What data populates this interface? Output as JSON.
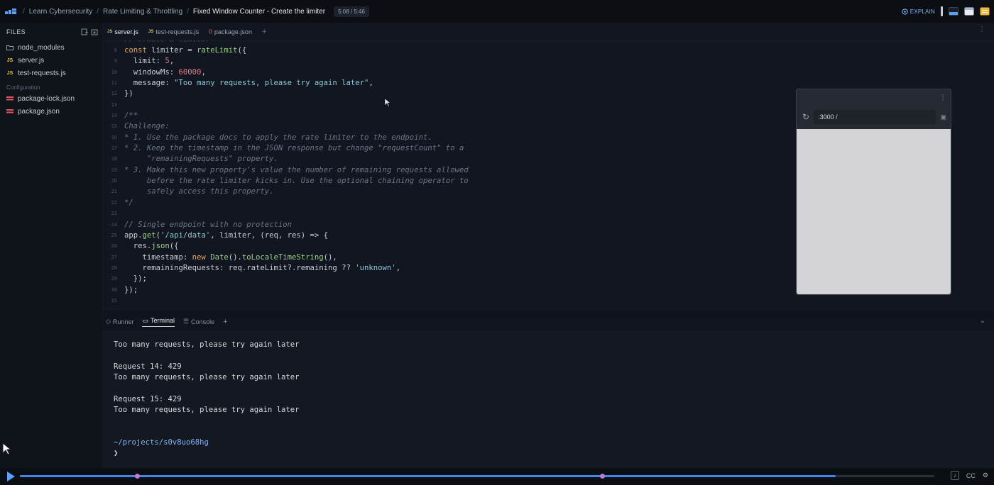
{
  "topbar": {
    "breadcrumb": [
      "Learn Cybersecurity",
      "Rate Limiting & Throttling"
    ],
    "current": "Fixed Window Counter - Create the limiter",
    "time": "5:08 / 5:46",
    "explain_label": "EXPLAIN",
    "accent": "#5aa0ff"
  },
  "sidebar": {
    "title": "FILES",
    "items": [
      {
        "icon": "folder-icon",
        "label": "node_modules"
      },
      {
        "icon": "js-file-icon",
        "badge": "JS",
        "label": "server.js"
      },
      {
        "icon": "js-file-icon",
        "badge": "JS",
        "label": "test-requests.js"
      }
    ],
    "section": "Configuration",
    "config_items": [
      {
        "icon": "json-file-icon",
        "label": "package-lock.json"
      },
      {
        "icon": "json-file-icon",
        "label": "package.json"
      }
    ]
  },
  "editor": {
    "tabs": [
      {
        "badge": "JS",
        "label": "server.js",
        "active": true
      },
      {
        "badge": "JS",
        "label": "test-requests.js",
        "active": false
      },
      {
        "badge": "{}",
        "label": "package.json",
        "active": false
      }
    ],
    "lines": [
      {
        "n": "",
        "tokens": [
          [
            "cm",
            "// create a limiter"
          ]
        ]
      },
      {
        "n": "8",
        "tokens": [
          [
            "kw",
            "const "
          ],
          [
            "",
            "limiter = "
          ],
          [
            "fn",
            "rateLimit"
          ],
          [
            "",
            "({"
          ]
        ]
      },
      {
        "n": "9",
        "tokens": [
          [
            "",
            "  limit: "
          ],
          [
            "num",
            "5"
          ],
          [
            "",
            ","
          ]
        ]
      },
      {
        "n": "10",
        "tokens": [
          [
            "",
            "  windowMs: "
          ],
          [
            "num",
            "60000"
          ],
          [
            "",
            ","
          ]
        ]
      },
      {
        "n": "11",
        "tokens": [
          [
            "",
            "  message: "
          ],
          [
            "str",
            "\"Too many requests, please try again later\""
          ],
          [
            "",
            ","
          ]
        ]
      },
      {
        "n": "12",
        "tokens": [
          [
            "",
            "})"
          ]
        ]
      },
      {
        "n": "13",
        "tokens": []
      },
      {
        "n": "14",
        "tokens": [
          [
            "cm",
            "/**"
          ]
        ]
      },
      {
        "n": "15",
        "tokens": [
          [
            "cm",
            "Challenge:"
          ]
        ]
      },
      {
        "n": "16",
        "tokens": [
          [
            "cm",
            "* 1. Use the package docs to apply the rate limiter to the endpoint."
          ]
        ]
      },
      {
        "n": "17",
        "tokens": [
          [
            "cm",
            "* 2. Keep the timestamp in the JSON response but change \"requestCount\" to a"
          ]
        ]
      },
      {
        "n": "18",
        "tokens": [
          [
            "cm",
            "     \"remainingRequests\" property."
          ]
        ]
      },
      {
        "n": "19",
        "tokens": [
          [
            "cm",
            "* 3. Make this new property's value the number of remaining requests allowed"
          ]
        ]
      },
      {
        "n": "20",
        "tokens": [
          [
            "cm",
            "     before the rate limiter kicks in. Use the optional chaining operator to"
          ]
        ]
      },
      {
        "n": "21",
        "tokens": [
          [
            "cm",
            "     safely access this property."
          ]
        ]
      },
      {
        "n": "22",
        "tokens": [
          [
            "cm",
            "*/"
          ]
        ]
      },
      {
        "n": "23",
        "tokens": []
      },
      {
        "n": "24",
        "tokens": [
          [
            "cm",
            "// Single endpoint with no protection"
          ]
        ]
      },
      {
        "n": "25",
        "tokens": [
          [
            "",
            "app."
          ],
          [
            "fn",
            "get"
          ],
          [
            "",
            "("
          ],
          [
            "str",
            "'/api/data'"
          ],
          [
            "",
            ", limiter, (req, res) => {"
          ]
        ]
      },
      {
        "n": "26",
        "tokens": [
          [
            "",
            "  res."
          ],
          [
            "fn",
            "json"
          ],
          [
            "",
            "({"
          ]
        ]
      },
      {
        "n": "27",
        "tokens": [
          [
            "",
            "    timestamp: "
          ],
          [
            "kw",
            "new "
          ],
          [
            "fn",
            "Date"
          ],
          [
            "",
            "()."
          ],
          [
            "fn",
            "toLocaleTimeString"
          ],
          [
            "",
            "(),"
          ]
        ]
      },
      {
        "n": "28",
        "tokens": [
          [
            "",
            "    remainingRequests: req.rateLimit?.remaining ?? "
          ],
          [
            "str",
            "'unknown'"
          ],
          [
            "",
            ","
          ]
        ]
      },
      {
        "n": "29",
        "tokens": [
          [
            "",
            "  });"
          ]
        ]
      },
      {
        "n": "30",
        "tokens": [
          [
            "",
            "});"
          ]
        ]
      },
      {
        "n": "31",
        "tokens": []
      }
    ]
  },
  "preview": {
    "address": ":3000 /"
  },
  "panel": {
    "tabs": [
      {
        "label": "Runner",
        "active": false
      },
      {
        "label": "Terminal",
        "active": true
      },
      {
        "label": "Console",
        "active": false
      }
    ],
    "lines": [
      {
        "kind": "text",
        "text": "Too many requests, please try again later"
      },
      {
        "kind": "text",
        "text": ""
      },
      {
        "kind": "text",
        "text": "Request 14: 429"
      },
      {
        "kind": "text",
        "text": "Too many requests, please try again later"
      },
      {
        "kind": "text",
        "text": ""
      },
      {
        "kind": "text",
        "text": "Request 15: 429"
      },
      {
        "kind": "text",
        "text": "Too many requests, please try again later"
      },
      {
        "kind": "text",
        "text": ""
      },
      {
        "kind": "text",
        "text": ""
      },
      {
        "kind": "path",
        "text": "~/projects/s0v8uo68hg"
      },
      {
        "kind": "text",
        "text": "❯"
      }
    ]
  },
  "player": {
    "progress": 0.892,
    "markers": [
      0.128,
      0.637
    ],
    "cc_label": "CC"
  }
}
